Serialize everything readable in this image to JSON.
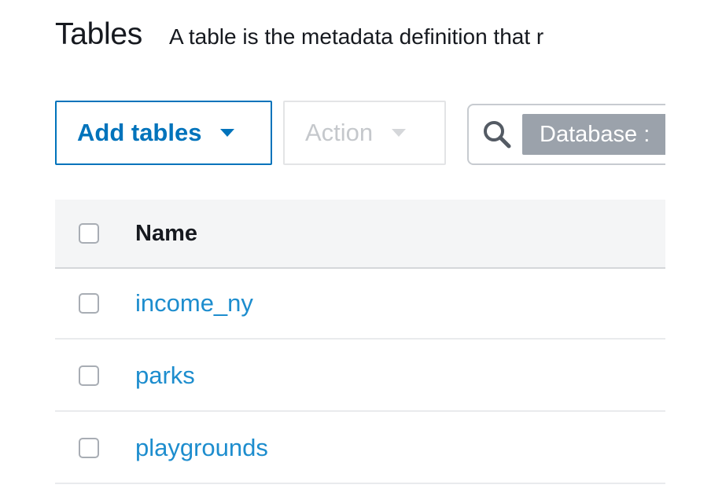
{
  "header": {
    "title": "Tables",
    "description": "A table is the metadata definition that r"
  },
  "toolbar": {
    "add_tables_label": "Add tables",
    "action_label": "Action",
    "filter_token": "Database :"
  },
  "table": {
    "columns": [
      "Name"
    ],
    "rows": [
      {
        "name": "income_ny"
      },
      {
        "name": "parks"
      },
      {
        "name": "playgrounds"
      }
    ]
  },
  "colors": {
    "accent": "#0073bb",
    "link": "#1d8dce",
    "disabled_text": "#c5c8cc",
    "token_bg": "#9ba2ab"
  },
  "icons": {
    "add_tables_dropdown": "caret-down-icon",
    "action_dropdown": "caret-down-icon",
    "search": "search-icon"
  }
}
